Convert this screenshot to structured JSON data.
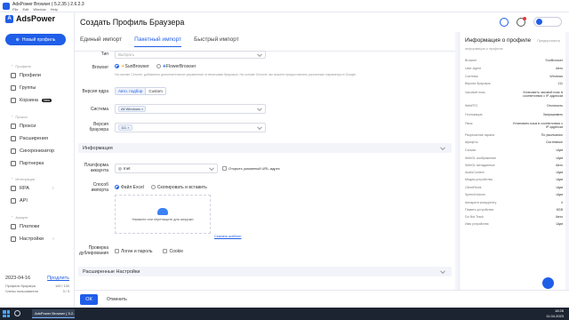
{
  "window": {
    "title": "AdsPower Browser ( 5.2.35 ) 2.6.2.3",
    "menu": [
      "File",
      "Edit",
      "Window",
      "Help"
    ]
  },
  "sidebar": {
    "brand": "AdsPower",
    "new_profile": "Новый профиль",
    "sections": {
      "profiles": "Профили",
      "proxies": "Прокси",
      "integration": "Интеграция",
      "account": "Аккаунт"
    },
    "items": {
      "profiles": "Профили",
      "groups": "Группы",
      "trash": "Корзина",
      "trash_badge": "New",
      "proxies": "Прокси",
      "extensions": "Расширения",
      "sync": "Синхронизатор",
      "partner": "Партнерка",
      "rpa": "RPA",
      "api": "API",
      "billing": "Платежи",
      "settings": "Настройки"
    },
    "footer": {
      "date": "2023-04-16",
      "renew": "Продлить",
      "profiles_label": "Профили браузера",
      "profiles_value": "100 / 100",
      "members_label": "Члены пользователя",
      "members_value": "3 / 3"
    }
  },
  "header": {
    "title": "Создать Профиль Браузера"
  },
  "tabs": [
    "Единый импорт",
    "Пакетный импорт",
    "Быстрый импорт"
  ],
  "form": {
    "type": {
      "label": "Тип",
      "placeholder": "Выбрать"
    },
    "browser": {
      "label": "Browser",
      "options": [
        "SunBrowser",
        "FlowerBrowser"
      ],
      "hint": "На основе Chrome, добавлено дополнительное управление отпечатками браузера. На основе Chrome, вы можете предоставлять различные параметры в Google."
    },
    "core": {
      "label": "Версия ядра",
      "options": [
        "Авто. подбор",
        "Custom"
      ]
    },
    "os": {
      "label": "Система",
      "value": "All Windows"
    },
    "version": {
      "label": "Версия браузера",
      "value": "111"
    },
    "info_section": "Информация",
    "platform": {
      "label": "Платформа аккаунта",
      "value": "Inet",
      "checkbox": "Открыть указанный URL-адрес"
    },
    "import": {
      "label": "Способ импорта",
      "options": [
        "Файл Excel",
        "Скопировать и вставить"
      ],
      "upload_text": "Нажмите или перетащите для загрузки",
      "template": "Скачать шаблон"
    },
    "dedupe": {
      "label": "Проверка дублирования",
      "options": [
        "Логин и пароль",
        "Cookie"
      ]
    },
    "advanced_section": "Расширенные Настройки"
  },
  "footer": {
    "ok": "ОК",
    "cancel": "Отменить"
  },
  "panel": {
    "title": "Информация о профиле",
    "preview": "Предпросмотр",
    "subtitle": "информации о профиле",
    "rows": [
      [
        "Browser",
        "SunBrowser"
      ],
      [
        "User-Agent",
        "Авто"
      ],
      [
        "Система",
        "Windows"
      ],
      [
        "Версия браузера",
        "111"
      ],
      [
        "Часовой пояс",
        "Установить часовой пояс в соответствии с IP-адресом"
      ],
      [
        "WebRTC",
        "Отключить"
      ],
      [
        "Геолокация",
        "Запрашивать"
      ],
      [
        "Язык",
        "Установить язык в соответствии с IP-адресом"
      ],
      [
        "Разрешение экрана",
        "По умолчанию"
      ],
      [
        "Шрифты",
        "Системные"
      ],
      [
        "Canvas",
        "Шум"
      ],
      [
        "WebGL изображение",
        "Шум"
      ],
      [
        "WebGL метаданные",
        "Авто"
      ],
      [
        "AudioContext",
        "Шум"
      ],
      [
        "Медиа-устройства",
        "Шум"
      ],
      [
        "ClientRects",
        "Шум"
      ],
      [
        "SpeechVoices",
        "Шум"
      ],
      [
        "Аппаратн.конкуренту",
        "4"
      ],
      [
        "Память устройства",
        "8GB"
      ],
      [
        "Do Not Track",
        "Авто"
      ],
      [
        "Имя устройства",
        "Шум"
      ]
    ]
  },
  "taskbar": {
    "app": "AdsPower Browser ( 5.2...",
    "time": "18:26",
    "date": "11.04.2023"
  }
}
